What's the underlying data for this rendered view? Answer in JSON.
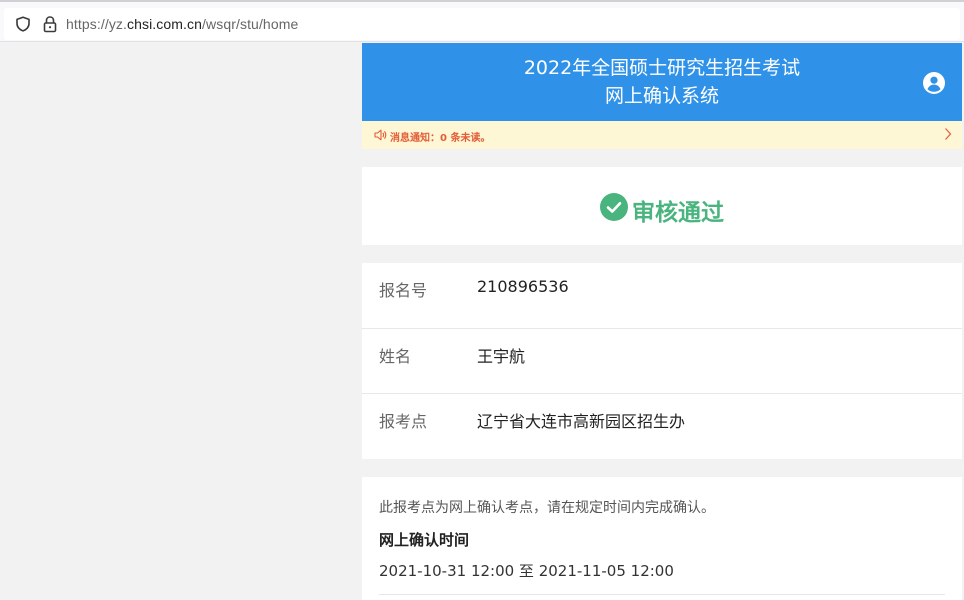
{
  "browser": {
    "url_prefix": "https://yz.",
    "url_host": "chsi.com.cn",
    "url_path": "/wsqr/stu/home"
  },
  "header": {
    "title_line1": "2022年全国硕士研究生招生考试",
    "title_line2": "网上确认系统",
    "user_icon": "user-circle-icon",
    "background_color": "#2f92e8"
  },
  "notice": {
    "text": "消息通知：0 条未读。",
    "icon": "speaker-icon"
  },
  "status": {
    "text": "审核通过",
    "color": "#4ab47f",
    "icon": "check-circle-icon"
  },
  "info": {
    "rows": [
      {
        "label": "报名号",
        "value": "210896536"
      },
      {
        "label": "姓名",
        "value": "王宇航"
      },
      {
        "label": "报考点",
        "value": "辽宁省大连市高新园区招生办"
      }
    ]
  },
  "confirm": {
    "description": "此报考点为网上确认考点，请在规定时间内完成确认。",
    "time_heading": "网上确认时间",
    "time_range": "2021-10-31 12:00 至 2021-11-05 12:00"
  }
}
